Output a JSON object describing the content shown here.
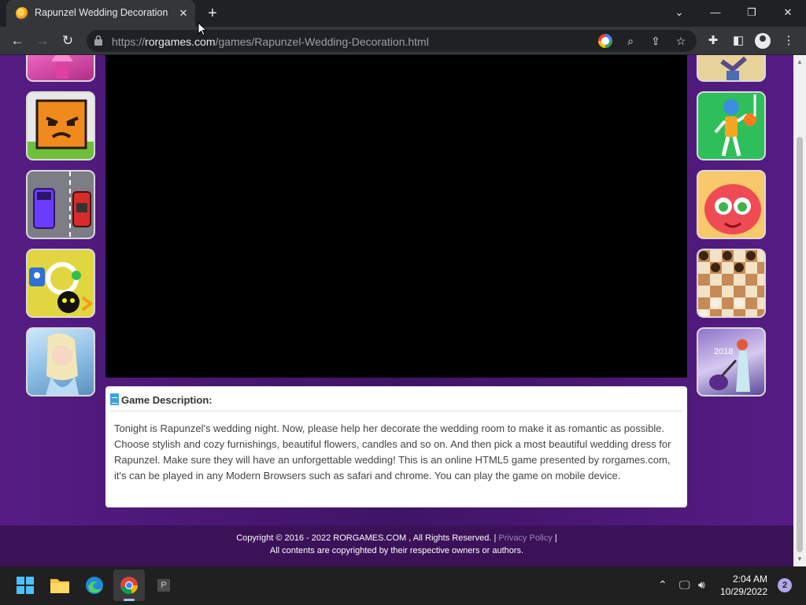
{
  "browser": {
    "tab": {
      "title": "Rapunzel Wedding Decoration - "
    },
    "url": {
      "prefix": "https://",
      "domain": "rorgames.com",
      "path": "/games/Rapunzel-Wedding-Decoration.html"
    }
  },
  "page": {
    "left_thumbnails": [
      "princess-pink-dress",
      "angry-box-face",
      "car-traffic",
      "monster-puzzle",
      "frozen-elsa"
    ],
    "right_thumbnails": [
      "zombie-dance",
      "basketball-stickman",
      "red-jelly-monster",
      "checkers",
      "2018-fashion-guitar"
    ],
    "description": {
      "title": "Game Description:",
      "text": "Tonight is Rapunzel's wedding night. Now, please help her decorate the wedding room to make it as romantic as possible. Choose stylish and cozy furnishings, beautiful flowers, candles and so on. And then pick a most beautiful wedding dress for Rapunzel. Make sure they will have an unforgettable wedding! This is an online HTML5 game presented by rorgames.com, it's can be played in any Modern Browsers such as safari and chrome. You can play the game on mobile device."
    },
    "footer": {
      "copyright": "Copyright © 2016 - 2022 RORGAMES.COM , All Rights Reserved. | ",
      "privacy": "Privacy Policy",
      "separator": " |",
      "line2": "All contents are copyrighted by their respective owners or authors."
    }
  },
  "taskbar": {
    "time": "2:04 AM",
    "date": "10/29/2022",
    "notification_count": "2",
    "pinned_app_letter": "P"
  },
  "colors": {
    "page_purple": "#4a1a75",
    "footer_purple": "#3b1158",
    "game_frame": "#000000",
    "link_muted": "#9a86b7"
  }
}
